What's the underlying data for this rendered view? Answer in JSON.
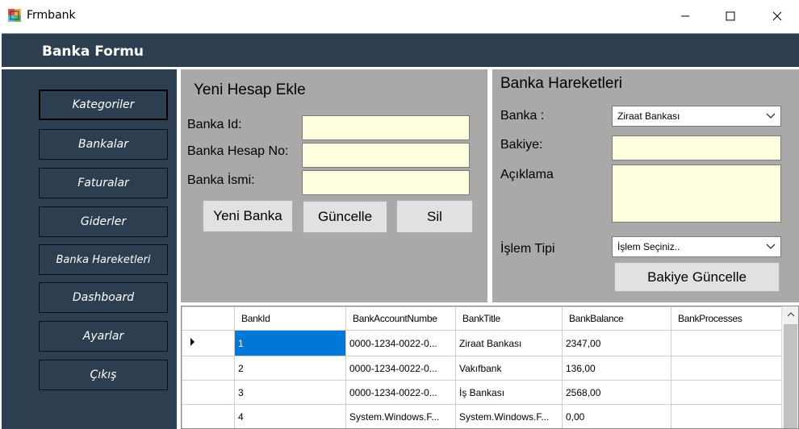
{
  "window": {
    "title": "Frmbank"
  },
  "header": {
    "title": "Banka Formu"
  },
  "sidebar": {
    "items": [
      {
        "label": "Kategoriler"
      },
      {
        "label": "Bankalar"
      },
      {
        "label": "Faturalar"
      },
      {
        "label": "Giderler"
      },
      {
        "label": "Banka Hareketleri"
      },
      {
        "label": "Dashboard"
      },
      {
        "label": "Ayarlar"
      },
      {
        "label": "Çıkış"
      }
    ]
  },
  "new_account": {
    "title": "Yeni Hesap Ekle",
    "bank_id_label": "Banka Id:",
    "bank_id_value": "",
    "account_no_label": "Banka Hesap No:",
    "account_no_value": "",
    "bank_name_label": "Banka İsmi:",
    "bank_name_value": "",
    "new_button": "Yeni Banka",
    "update_button": "Güncelle",
    "delete_button": "Sil"
  },
  "transactions": {
    "title": "Banka Hareketleri",
    "bank_label": "Banka :",
    "bank_selected": "Ziraat Bankası",
    "balance_label": "Bakiye:",
    "balance_value": "",
    "description_label": "Açıklama",
    "description_value": "",
    "type_label": "İşlem Tipi",
    "type_selected": "İşlem Seçiniz..",
    "update_balance_button": "Bakiye Güncelle"
  },
  "grid": {
    "columns": [
      "BankId",
      "BankAccountNumbe",
      "BankTitle",
      "BankBalance",
      "BankProcesses"
    ],
    "rows": [
      {
        "id": "1",
        "account": "0000-1234-0022-0...",
        "title": "Ziraat Bankası",
        "balance": "2347,00",
        "processes": ""
      },
      {
        "id": "2",
        "account": "0000-1234-0022-0...",
        "title": "Vakıfbank",
        "balance": "136,00",
        "processes": ""
      },
      {
        "id": "3",
        "account": "0000-1234-0022-0...",
        "title": "İş Bankası",
        "balance": "2568,00",
        "processes": ""
      },
      {
        "id": "4",
        "account": "System.Windows.F...",
        "title": "System.Windows.F...",
        "balance": "0,00",
        "processes": ""
      }
    ]
  },
  "colors": {
    "navy": "#2c3e50",
    "panel_gray": "#a9a9a9",
    "input_yellow": "#ffffe0",
    "selection_blue": "#0078d7"
  },
  "icons": {
    "app": "app-window-icon",
    "minimize": "minimize-icon",
    "maximize": "maximize-icon",
    "close": "close-icon"
  }
}
